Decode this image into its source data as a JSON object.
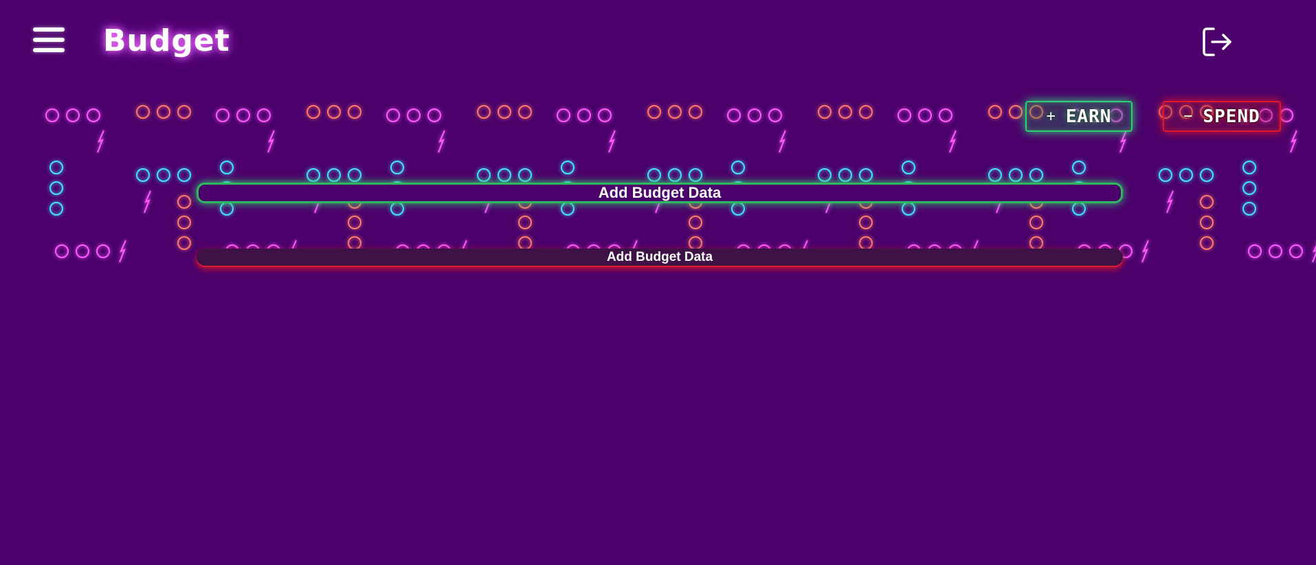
{
  "header": {
    "title": "Budget",
    "menu_icon": "hamburger-menu-icon",
    "logout_icon": "logout-icon"
  },
  "actions": {
    "earn": {
      "symbol": "+",
      "label": "EARN",
      "color": "#2fd071"
    },
    "spend": {
      "symbol": "−",
      "label": "SPEND",
      "color": "#e0182b"
    }
  },
  "forms": {
    "earn_submit_label": "Add Budget Data",
    "spend_submit_label": "Add Budget Data"
  },
  "colors": {
    "background": "#4b006b",
    "neon_pink": "#ff5cff",
    "neon_orange": "#ff7a6b",
    "neon_cyan": "#45e3ff",
    "neon_green": "#2fd071"
  }
}
